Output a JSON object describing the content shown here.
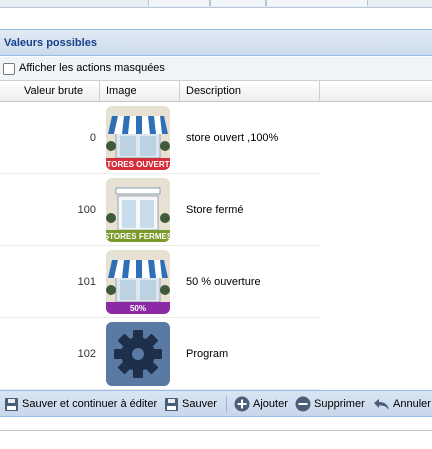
{
  "panel": {
    "title": "Valeurs possibles"
  },
  "options": {
    "show_hidden_label": "Afficher les actions masquées",
    "show_hidden_checked": false
  },
  "columns": [
    "Valeur brute",
    "Image",
    "Description"
  ],
  "rows": [
    {
      "raw": "0",
      "description": "store ouvert ,100%",
      "image": {
        "icon": "store-awning-icon",
        "banner": "STORES OUVERTS",
        "banner_color": "#d32f3a"
      }
    },
    {
      "raw": "100",
      "description": "Store fermé",
      "image": {
        "icon": "store-window-icon",
        "banner": "STORES FERMES",
        "banner_color": "#7a9a2a"
      }
    },
    {
      "raw": "101",
      "description": "50 % ouverture",
      "image": {
        "icon": "store-awning-icon",
        "banner": "50%",
        "banner_color": "#8c2aa6"
      }
    },
    {
      "raw": "102",
      "description": "Program",
      "image": {
        "icon": "gear-icon",
        "tile_color": "#5a7aa3"
      }
    }
  ],
  "toolbar": {
    "save_continue": "Sauver et continuer à éditer",
    "save": "Sauver",
    "add": "Ajouter",
    "delete": "Supprimer",
    "cancel": "Annuler"
  }
}
